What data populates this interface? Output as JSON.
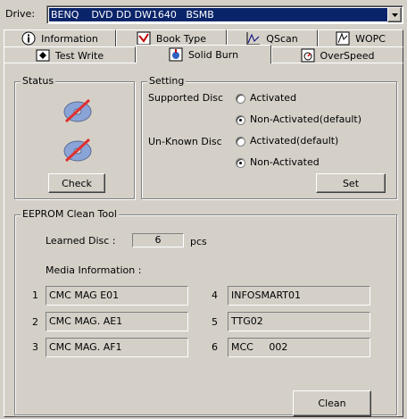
{
  "drive": {
    "label": "Drive:",
    "value": "BENQ    DVD DD DW1640   BSMB"
  },
  "tabs_row1": [
    {
      "label": "Information",
      "icon": "info-icon"
    },
    {
      "label": "Book Type",
      "icon": "book-type-icon"
    },
    {
      "label": "QScan",
      "icon": "qscan-icon"
    },
    {
      "label": "WOPC",
      "icon": "wopc-icon"
    }
  ],
  "tabs_row2": [
    {
      "label": "Test Write",
      "icon": "test-write-icon"
    },
    {
      "label": "Solid Burn",
      "icon": "solid-burn-icon",
      "active": true
    },
    {
      "label": "OverSpeed",
      "icon": "overspeed-icon"
    }
  ],
  "status": {
    "title": "Status",
    "check_label": "Check"
  },
  "setting": {
    "title": "Setting",
    "supported_label": "Supported Disc",
    "supported_opt1": "Activated",
    "supported_opt2": "Non-Activated(default)",
    "supported_selected": "Non-Activated(default)",
    "unknown_label": "Un-Known Disc",
    "unknown_opt1": "Activated(default)",
    "unknown_opt2": "Non-Activated",
    "unknown_selected": "Non-Activated",
    "set_label": "Set"
  },
  "eeprom": {
    "title": "EEPROM Clean Tool",
    "learned_label": "Learned Disc :",
    "learned_value": "6",
    "learned_unit": "pcs",
    "media_label": "Media Information :",
    "media": [
      {
        "num": "1",
        "value": "CMC MAG E01"
      },
      {
        "num": "2",
        "value": "CMC MAG. AE1"
      },
      {
        "num": "3",
        "value": "CMC MAG. AF1"
      },
      {
        "num": "4",
        "value": "INFOSMART01"
      },
      {
        "num": "5",
        "value": "TTG02"
      },
      {
        "num": "6",
        "value": "MCC     002"
      }
    ],
    "clean_label": "Clean"
  },
  "colors": {
    "dropdown_selected_bg": "#0a246a",
    "window_bg": "#d4d0c8"
  }
}
